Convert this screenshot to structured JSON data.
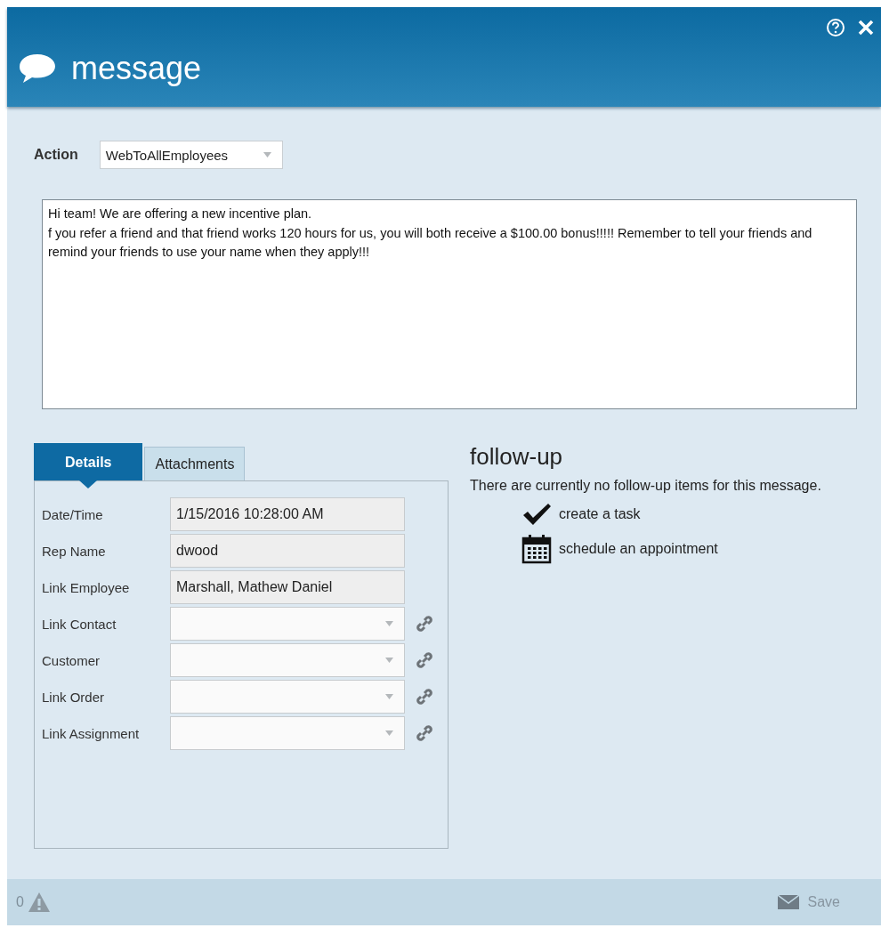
{
  "window": {
    "title": "message"
  },
  "action": {
    "label": "Action",
    "value": "WebToAllEmployees"
  },
  "message_body": [
    "Hi team!  We are offering a new incentive plan.",
    "f you refer a friend and that friend works 120 hours for us, you will both receive a $100.00 bonus!!!!!  Remember to tell your friends and remind your friends to use your name when they apply!!!"
  ],
  "tabs": [
    {
      "label": "Details",
      "selected": true
    },
    {
      "label": "Attachments",
      "selected": false
    }
  ],
  "fields": [
    {
      "label": "Date/Time",
      "kind": "text",
      "value": "1/15/2016 10:28:00 AM"
    },
    {
      "label": "Rep Name",
      "kind": "text",
      "value": "dwood"
    },
    {
      "label": "Link Employee",
      "kind": "text",
      "value": "Marshall, Mathew Daniel"
    },
    {
      "label": "Link Contact",
      "kind": "select"
    },
    {
      "label": "Customer",
      "kind": "select"
    },
    {
      "label": "Link Order",
      "kind": "select"
    },
    {
      "label": "Link Assignment",
      "kind": "select"
    }
  ],
  "follow_up": {
    "title": "follow-up",
    "note": "There are currently no follow-up items for this message.",
    "actions": [
      {
        "kind": "task",
        "label": "create a task"
      },
      {
        "kind": "appointment",
        "label": "schedule an appointment"
      }
    ]
  },
  "status_bar": {
    "warning_count": "0",
    "save": "Save"
  }
}
